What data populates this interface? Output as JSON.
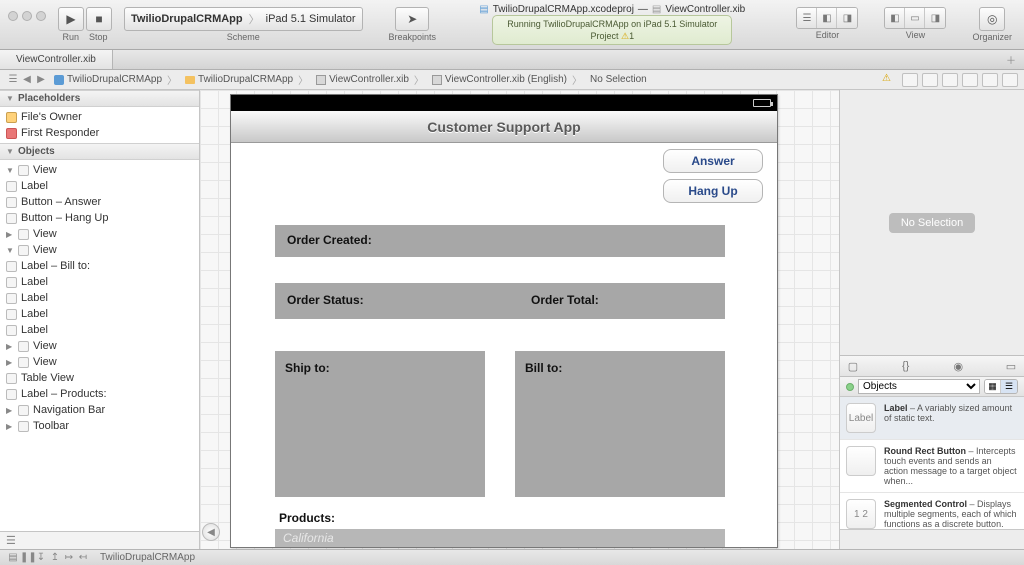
{
  "window": {
    "project_file": "TwilioDrupalCRMApp.xcodeproj",
    "xib_file": "ViewController.xib"
  },
  "toolbar": {
    "run_label": "Run",
    "stop_label": "Stop",
    "scheme_app": "TwilioDrupalCRMApp",
    "scheme_dest": "iPad 5.1 Simulator",
    "scheme_label": "Scheme",
    "breakpoints_label": "Breakpoints",
    "editor_label": "Editor",
    "view_label": "View",
    "organizer_label": "Organizer"
  },
  "status": {
    "line1a": "Running TwilioDrupalCRMApp on iPad 5.1 Simulator",
    "line2_label": "Project",
    "line2_warn": "1"
  },
  "tabbar": {
    "tab1": "ViewController.xib"
  },
  "path": {
    "app": "TwilioDrupalCRMApp",
    "folder": "TwilioDrupalCRMApp",
    "xib": "ViewController.xib",
    "xib_lang": "ViewController.xib (English)",
    "sel": "No Selection"
  },
  "outline": {
    "placeholders_header": "Placeholders",
    "files_owner": "File's Owner",
    "first_responder": "First Responder",
    "objects_header": "Objects",
    "tree": {
      "view": "View",
      "label": "Label",
      "btn_answer": "Button – Answer",
      "btn_hangup": "Button – Hang Up",
      "label_billto": "Label – Bill to:",
      "tableview": "Table View",
      "label_products": "Label – Products:",
      "navbar": "Navigation Bar",
      "toolbar": "Toolbar"
    }
  },
  "device": {
    "nav_title": "Customer Support App",
    "answer": "Answer",
    "hangup": "Hang Up",
    "order_created": "Order Created:",
    "order_status": "Order Status:",
    "order_total": "Order Total:",
    "ship_to": "Ship to:",
    "bill_to": "Bill to:",
    "products": "Products:",
    "table_placeholder": "California"
  },
  "inspector": {
    "no_selection": "No Selection",
    "objects_filter": "Objects"
  },
  "library": {
    "items": [
      {
        "thumb": "Label",
        "title": "Label",
        "desc": " – A variably sized amount of static text."
      },
      {
        "thumb": "",
        "title": "Round Rect Button",
        "desc": " – Intercepts touch events and sends an action message to a target object when..."
      },
      {
        "thumb": "1 2",
        "title": "Segmented Control",
        "desc": " – Displays multiple segments, each of which functions as a discrete button."
      }
    ]
  },
  "debug": {
    "target": "TwilioDrupalCRMApp"
  }
}
